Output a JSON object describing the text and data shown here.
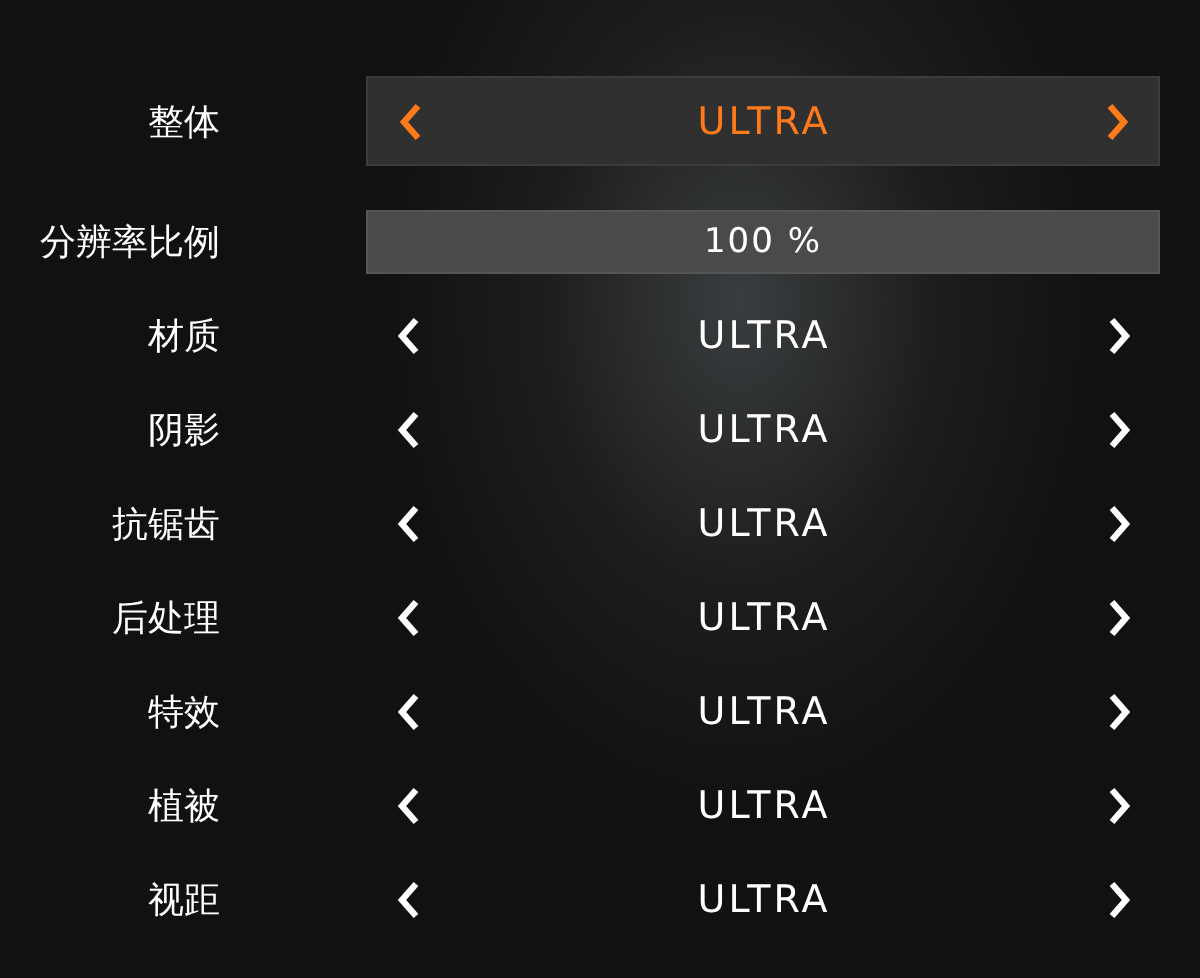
{
  "settings": [
    {
      "kind": "selector",
      "label": "整体",
      "value": "ULTRA",
      "selected": true
    },
    {
      "kind": "slider",
      "label": "分辨率比例",
      "value": "100 %",
      "level": 1
    },
    {
      "kind": "selector",
      "label": "材质",
      "value": "ULTRA",
      "selected": false
    },
    {
      "kind": "selector",
      "label": "阴影",
      "value": "ULTRA",
      "selected": false
    },
    {
      "kind": "selector",
      "label": "抗锯齿",
      "value": "ULTRA",
      "selected": false
    },
    {
      "kind": "selector",
      "label": "后处理",
      "value": "ULTRA",
      "selected": false
    },
    {
      "kind": "selector",
      "label": "特效",
      "value": "ULTRA",
      "selected": false
    },
    {
      "kind": "selector",
      "label": "植被",
      "value": "ULTRA",
      "selected": false
    },
    {
      "kind": "selector",
      "label": "视距",
      "value": "ULTRA",
      "selected": false
    }
  ]
}
